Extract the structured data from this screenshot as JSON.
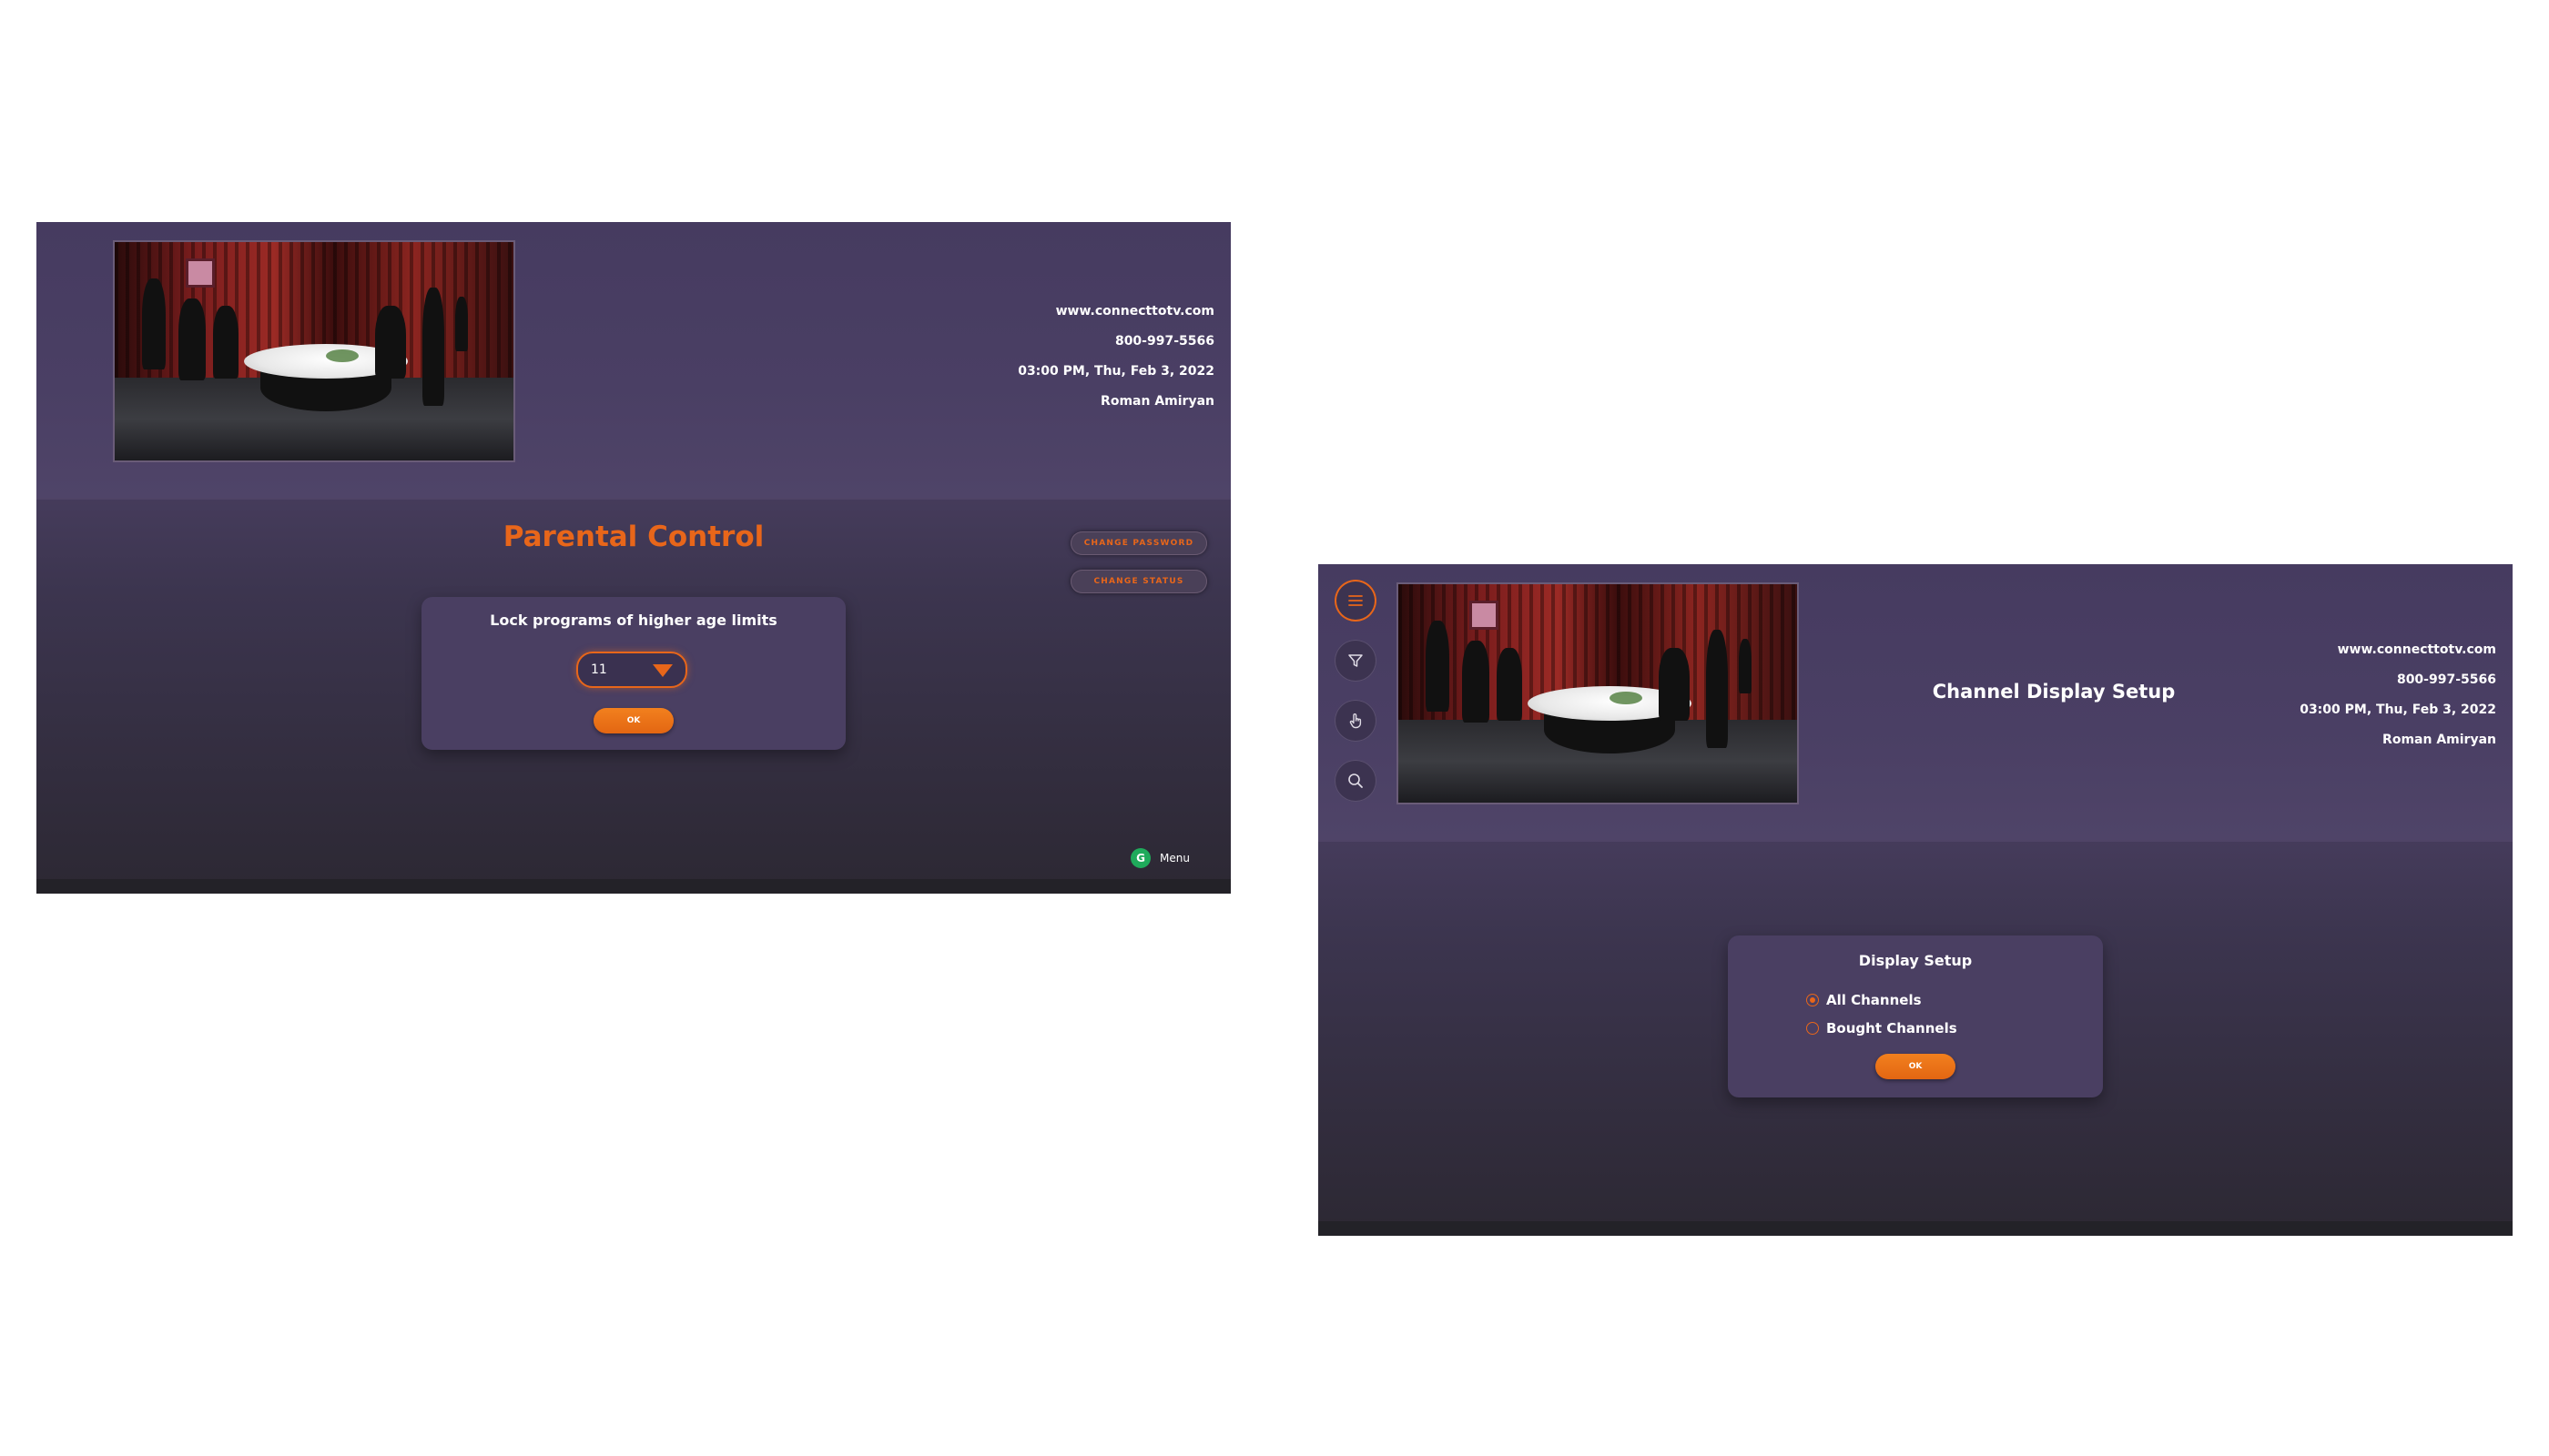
{
  "screen_a": {
    "info": {
      "website": "www.connecttotv.com",
      "phone": "800-997-5566",
      "datetime": "03:00 PM, Thu, Feb 3, 2022",
      "user": "Roman Amiryan"
    },
    "page_title": "Parental Control",
    "buttons": {
      "change_password": "CHANGE PASSWORD",
      "change_status": "CHANGE STATUS"
    },
    "dialog": {
      "title": "Lock programs of higher age limits",
      "age_select": {
        "value": "11"
      },
      "ok_label": "OK"
    },
    "footer": {
      "badge": "G",
      "menu_label": "Menu"
    }
  },
  "screen_b": {
    "sidebar": [
      {
        "name": "menu",
        "icon": "hamburger-icon"
      },
      {
        "name": "filter",
        "icon": "filter-icon"
      },
      {
        "name": "touch",
        "icon": "hand-pointer-icon"
      },
      {
        "name": "search",
        "icon": "search-icon"
      }
    ],
    "page_title": "Channel Display Setup",
    "info": {
      "website": "www.connecttotv.com",
      "phone": "800-997-5566",
      "datetime": "03:00 PM, Thu, Feb 3, 2022",
      "user": "Roman Amiryan"
    },
    "dialog": {
      "title": "Display Setup",
      "options": [
        {
          "label": "All Channels",
          "selected": true
        },
        {
          "label": "Bought Channels",
          "selected": false
        }
      ],
      "ok_label": "OK"
    }
  },
  "colors": {
    "accent": "#e8661a",
    "background": "#463c5c",
    "dialog": "#4a3f62"
  }
}
